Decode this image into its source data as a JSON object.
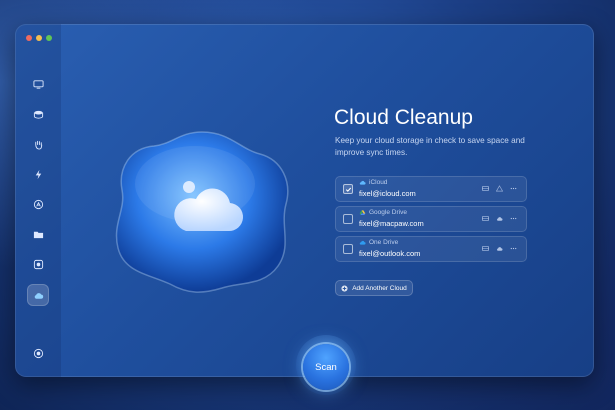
{
  "app": {
    "title": "Cloud Cleanup",
    "subtitle": "Keep your cloud storage in check to save space and improve sync times."
  },
  "sidebar": {
    "items": [
      {
        "name": "smart-care",
        "icon": "monitor-icon"
      },
      {
        "name": "cleanup",
        "icon": "disk-icon"
      },
      {
        "name": "protection",
        "icon": "hand-icon"
      },
      {
        "name": "performance",
        "icon": "lightning-icon"
      },
      {
        "name": "applications",
        "icon": "apps-icon"
      },
      {
        "name": "my-clutter",
        "icon": "folder-icon"
      },
      {
        "name": "space-lens",
        "icon": "lens-icon"
      },
      {
        "name": "cloud-cleanup",
        "icon": "cloud-icon",
        "active": true
      }
    ],
    "bottom_icon": "assistant-icon"
  },
  "accounts": [
    {
      "provider": "iCloud",
      "email": "fixel@icloud.com",
      "checked": true
    },
    {
      "provider": "Google Drive",
      "email": "fixel@macpaw.com",
      "checked": false
    },
    {
      "provider": "One Drive",
      "email": "fixel@outlook.com",
      "checked": false
    }
  ],
  "add_button_label": "Add Another Cloud",
  "scan_label": "Scan",
  "colors": {
    "accent": "#2a73e0",
    "window_bg": "#1f4f9e"
  }
}
